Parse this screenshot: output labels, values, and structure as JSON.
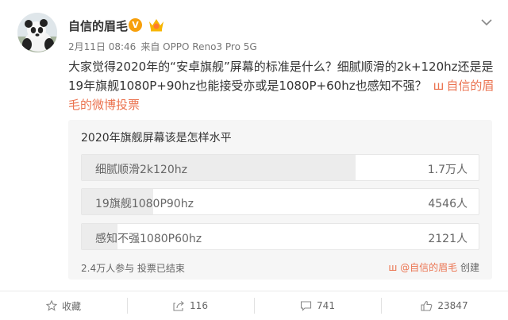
{
  "author": {
    "name": "自信的眉毛",
    "verified_badge": "V"
  },
  "meta": {
    "time": "2月11日 08:46",
    "source": "来自 OPPO Reno3 Pro 5G"
  },
  "content": {
    "text": "大家觉得2020年的“安卓旗舰”屏幕的标准是什么？细腻顺滑的2k+120hz还是是19年旗舰1080P+90hz也能接受亦或是1080P+60hz也感知不强？",
    "link_icon": "ш",
    "link_text": "自信的眉毛的微博投票"
  },
  "poll": {
    "title": "2020年旗舰屏幕该是怎样水平",
    "options": [
      {
        "label": "细腻顺滑2k120hz",
        "count": "1.7万人",
        "share": 0.69
      },
      {
        "label": "19旗舰1080P90hz",
        "count": "4546人",
        "share": 0.18
      },
      {
        "label": "感知不强1080P60hz",
        "count": "2121人",
        "share": 0.09
      }
    ],
    "footer": "2.4万人参与  投票已结束",
    "creator_icon": "ш",
    "creator_name": "@自信的眉毛",
    "creator_suffix": "创建"
  },
  "actions": {
    "favorite": "收藏",
    "repost": "116",
    "comment": "741",
    "like": "23847"
  },
  "colors": {
    "link": "#eb7350",
    "badge": "#f7a00c"
  }
}
